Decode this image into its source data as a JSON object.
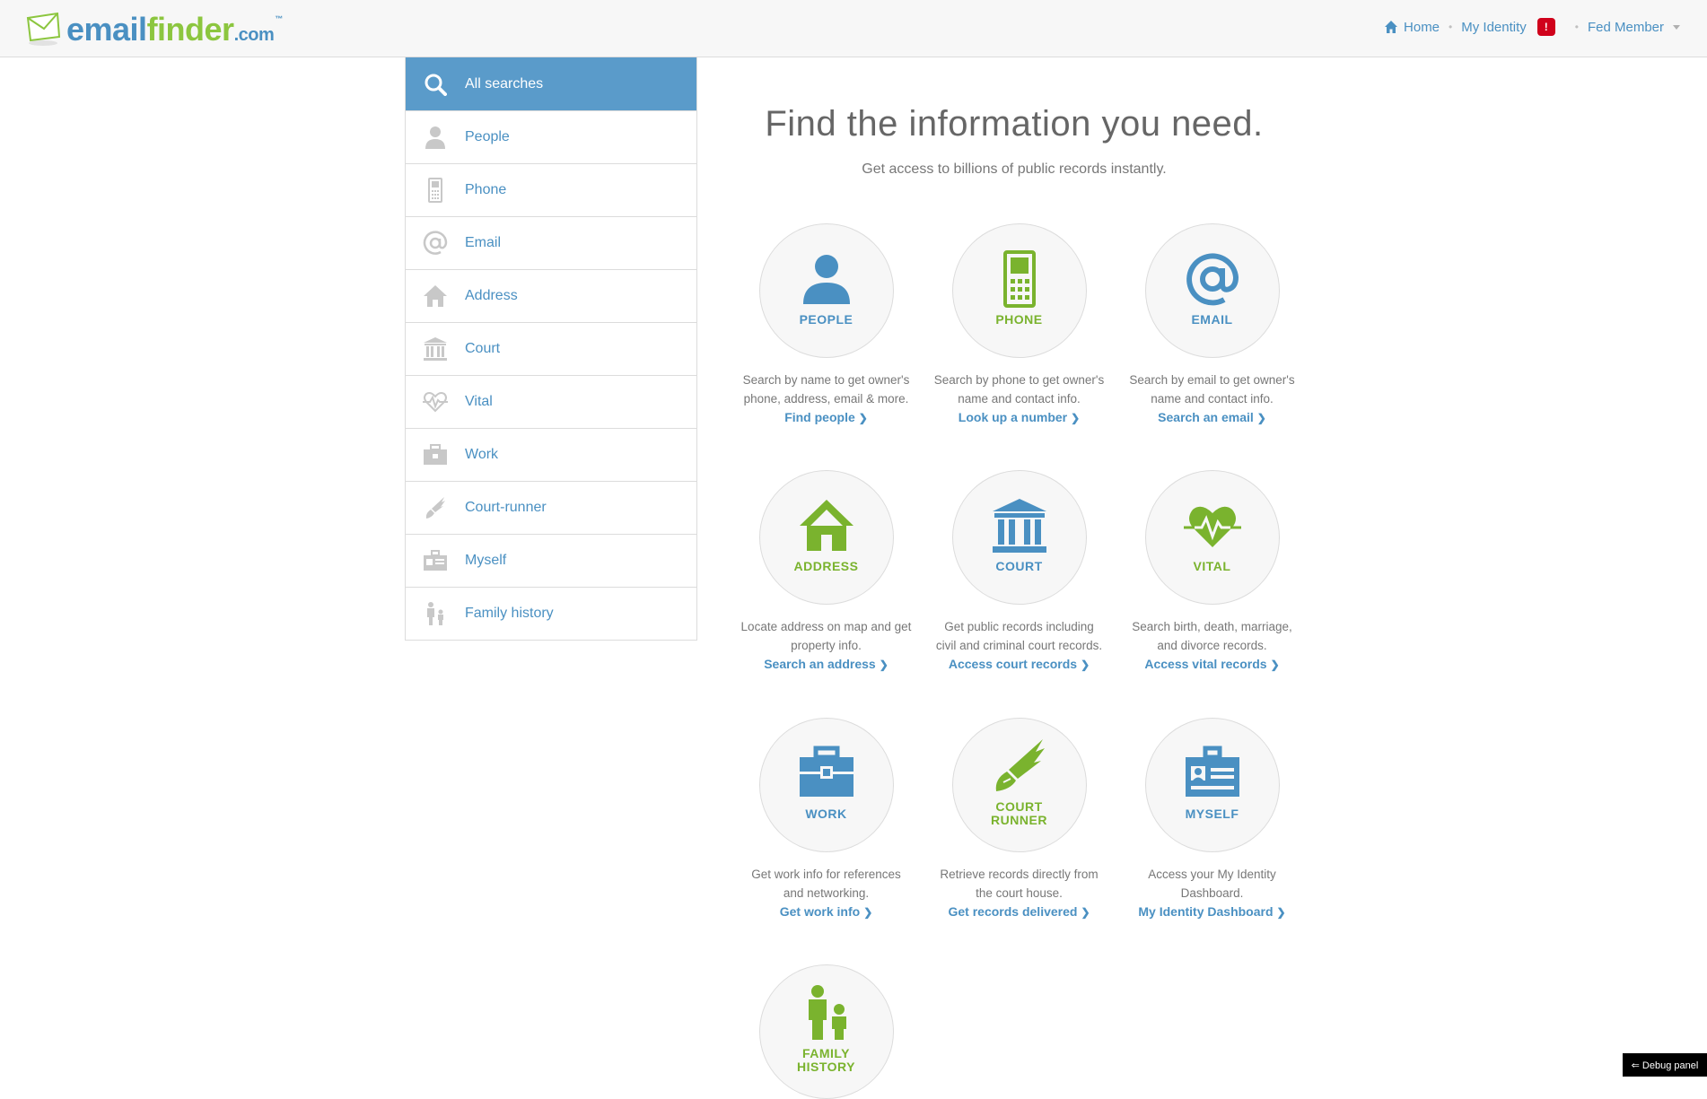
{
  "header": {
    "logo": {
      "part1": "email",
      "part2": "finder",
      "part3": ".com",
      "tm": "™"
    },
    "nav": {
      "home": "Home",
      "identity": "My Identity",
      "alert": "!",
      "member": "Fed Member"
    }
  },
  "sidebar": {
    "items": [
      {
        "label": "All searches",
        "icon": "search-icon"
      },
      {
        "label": "People",
        "icon": "person-icon"
      },
      {
        "label": "Phone",
        "icon": "phone-icon"
      },
      {
        "label": "Email",
        "icon": "at-icon"
      },
      {
        "label": "Address",
        "icon": "house-icon"
      },
      {
        "label": "Court",
        "icon": "courthouse-icon"
      },
      {
        "label": "Vital",
        "icon": "heartbeat-icon"
      },
      {
        "label": "Work",
        "icon": "briefcase-icon"
      },
      {
        "label": "Court-runner",
        "icon": "winged-shoe-icon"
      },
      {
        "label": "Myself",
        "icon": "id-card-icon"
      },
      {
        "label": "Family history",
        "icon": "family-icon"
      }
    ]
  },
  "main": {
    "headline": "Find the information you need.",
    "subline": "Get access to billions of public records instantly.",
    "cards": [
      {
        "label": "PEOPLE",
        "desc1": "Search by name to get owner's",
        "desc2": "phone, address, email & more.",
        "link": "Find people",
        "icon": "person-icon",
        "color": "#4a90c2"
      },
      {
        "label": "PHONE",
        "desc1": "Search by phone to get owner's",
        "desc2": "name and contact info.",
        "link": "Look up a number",
        "icon": "phone-icon",
        "color": "#7ab32e"
      },
      {
        "label": "EMAIL",
        "desc1": "Search by email to get owner's",
        "desc2": "name and contact info.",
        "link": "Search an email",
        "icon": "at-icon",
        "color": "#4a90c2"
      },
      {
        "label": "ADDRESS",
        "desc1": "Locate address on map and get",
        "desc2": "property info.",
        "link": "Search an address",
        "icon": "house-icon",
        "color": "#7ab32e"
      },
      {
        "label": "COURT",
        "desc1": "Get public records including",
        "desc2": "civil and criminal court records.",
        "link": "Access court records",
        "icon": "courthouse-icon",
        "color": "#4a90c2"
      },
      {
        "label": "VITAL",
        "desc1": "Search birth, death, marriage,",
        "desc2": "and divorce records.",
        "link": "Access vital records",
        "icon": "heartbeat-icon",
        "color": "#7ab32e"
      },
      {
        "label": "WORK",
        "desc1": "Get work info for references",
        "desc2": "and networking.",
        "link": "Get work info",
        "icon": "briefcase-icon",
        "color": "#4a90c2"
      },
      {
        "label": "COURT RUNNER",
        "desc1": "Retrieve records directly from",
        "desc2": "the court house.",
        "link": "Get records delivered",
        "icon": "winged-shoe-icon",
        "color": "#7ab32e"
      },
      {
        "label": "MYSELF",
        "desc1": "Access your My Identity",
        "desc2": "Dashboard.",
        "link": "My Identity Dashboard",
        "icon": "id-card-icon",
        "color": "#4a90c2"
      },
      {
        "label": "FAMILY HISTORY",
        "desc1": "",
        "desc2": "",
        "link": "",
        "icon": "family-icon",
        "color": "#7ab32e"
      }
    ]
  },
  "debug": {
    "label": "⇐ Debug panel"
  }
}
